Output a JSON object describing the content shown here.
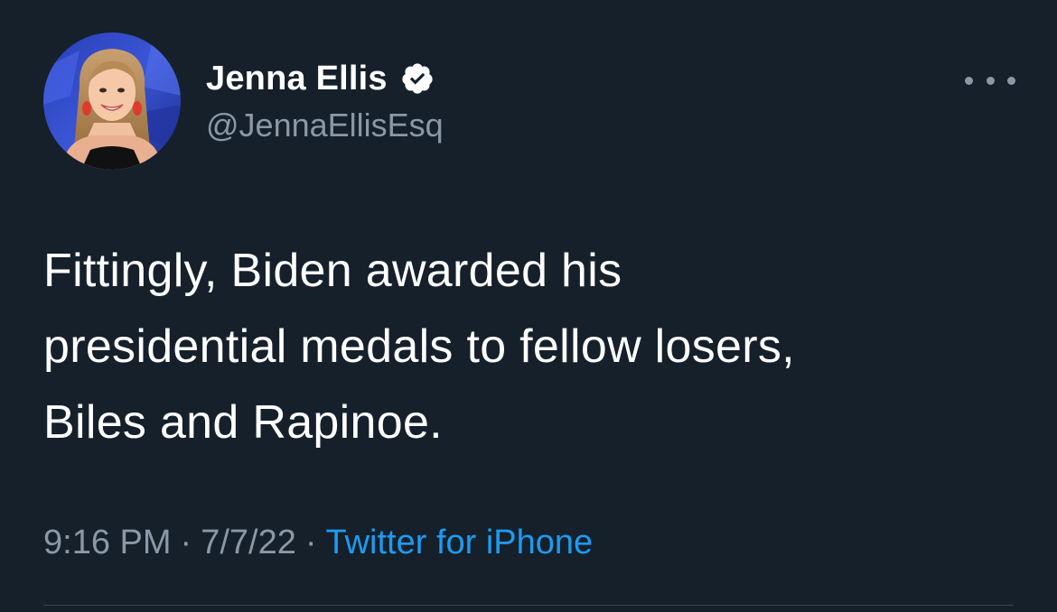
{
  "author": {
    "display_name": "Jenna Ellis",
    "handle": "@JennaEllisEsq",
    "verified": true,
    "verified_icon": "verified-badge-icon"
  },
  "menu": {
    "icon": "more-options-icon"
  },
  "tweet": {
    "lines": [
      "Fittingly, Biden awarded his",
      "presidential medals to fellow losers,",
      "Biles and Rapinoe."
    ],
    "time": "9:16 PM",
    "date": "7/7/22",
    "separator": "·",
    "source": "Twitter for iPhone"
  },
  "colors": {
    "background": "#15202b",
    "text_primary": "#ffffff",
    "text_secondary": "#8b98a5",
    "link": "#1d9bf0",
    "divider": "#38444d"
  }
}
